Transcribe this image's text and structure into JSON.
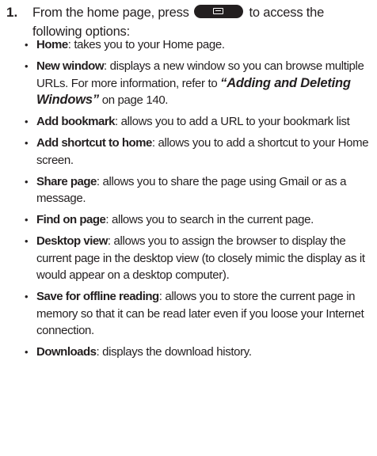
{
  "step": {
    "number": "1.",
    "text_before_key": "From the home page, press",
    "key_icon": "menu-key-icon",
    "text_after_key": "to access the following options:"
  },
  "options": [
    {
      "term": "Home",
      "sep": ":",
      "desc": " takes you to your Home page."
    },
    {
      "term": "New window",
      "sep": ":",
      "desc": " displays a new window so you can browse multiple URLs. For more information, refer to ",
      "xref": "“Adding and Deleting Windows”",
      "after": "  on page 140."
    },
    {
      "term": "Add bookmark",
      "sep": ":",
      "desc": " allows you to add a URL to your bookmark list"
    },
    {
      "term": "Add shortcut to home",
      "sep": ":",
      "desc": " allows you to add a shortcut to your Home screen."
    },
    {
      "term": "Share page",
      "sep": ":",
      "desc": " allows you to share the page using Gmail or as a message."
    },
    {
      "term": "Find on page",
      "sep": ":",
      "desc": " allows you to search in the current page."
    },
    {
      "term": "Desktop view",
      "sep": ":",
      "desc": " allows you to assign the browser to display the current page in the desktop view (to closely mimic the display as it would appear on a desktop computer)."
    },
    {
      "term": "Save for offline reading",
      "sep": ":",
      "desc": " allows you to store the current page in memory so that it can be read later even if you loose your Internet connection."
    },
    {
      "term": "Downloads",
      "sep": ":",
      "desc": " displays the download history."
    }
  ]
}
